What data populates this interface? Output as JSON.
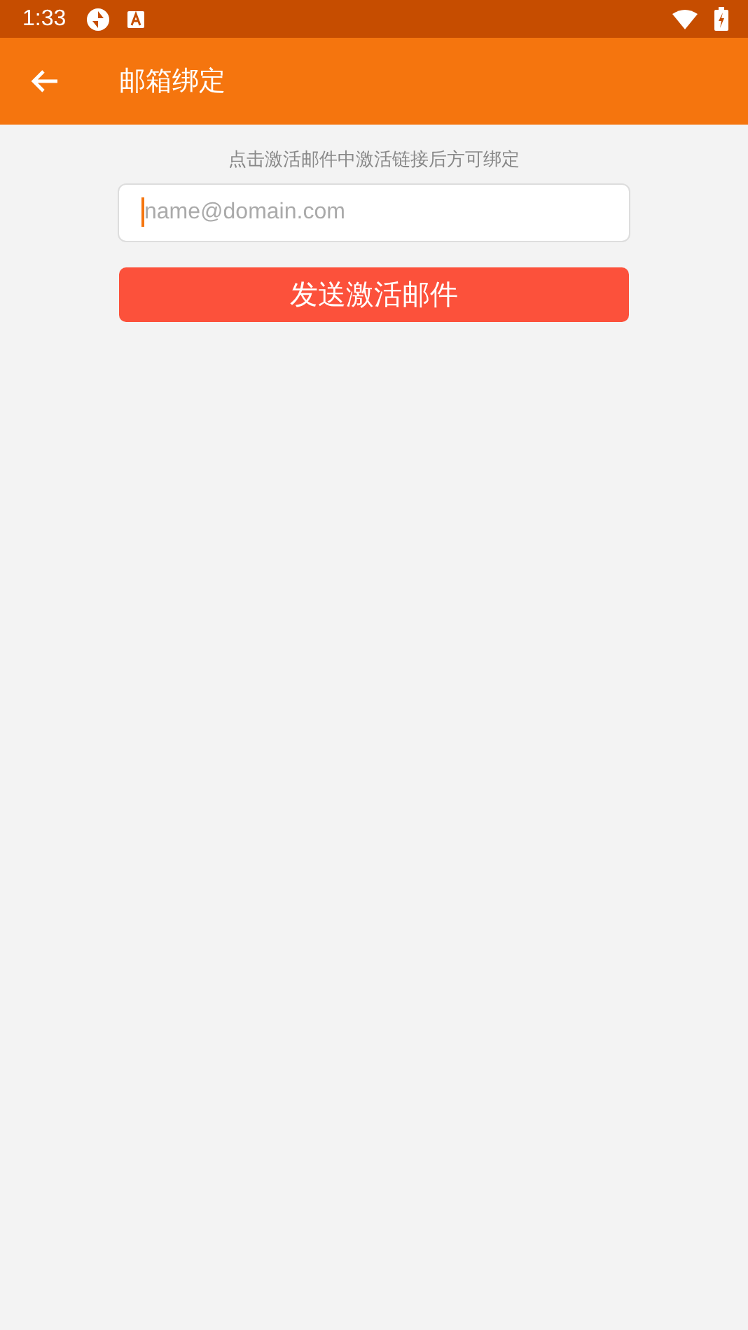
{
  "status_bar": {
    "time": "1:33"
  },
  "app_bar": {
    "title": "邮箱绑定"
  },
  "hint": "点击激活邮件中激活链接后方可绑定",
  "email_field": {
    "placeholder": "name@domain.com",
    "focused": true
  },
  "buttons": [
    "发送激活邮件"
  ]
}
